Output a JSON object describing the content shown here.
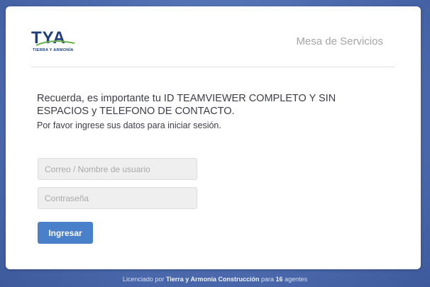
{
  "header": {
    "logo_text": "TYA",
    "logo_subtext": "TIERRA Y ARMONÍA",
    "title": "Mesa de Servicios"
  },
  "login": {
    "notice": "Recuerda, es importante tu ID TEAMVIEWER COMPLETO Y SIN ESPACIOS y TELEFONO DE CONTACTO.",
    "instruction": "Por favor ingrese sus datos para iniciar sesión.",
    "username_placeholder": "Correo / Nombre de usuario",
    "username_value": "",
    "password_placeholder": "Contraseña",
    "password_value": "",
    "submit_label": "Ingresar"
  },
  "footer": {
    "prefix": "Licenciado por",
    "company": "Tierra y Armonía Construcción",
    "middle": "para",
    "count": "16",
    "suffix": "agentes"
  },
  "colors": {
    "background": "#4e6db0",
    "accent": "#4a7fc9",
    "logo_blue": "#1e3f7a",
    "logo_green": "#6ab04c"
  }
}
